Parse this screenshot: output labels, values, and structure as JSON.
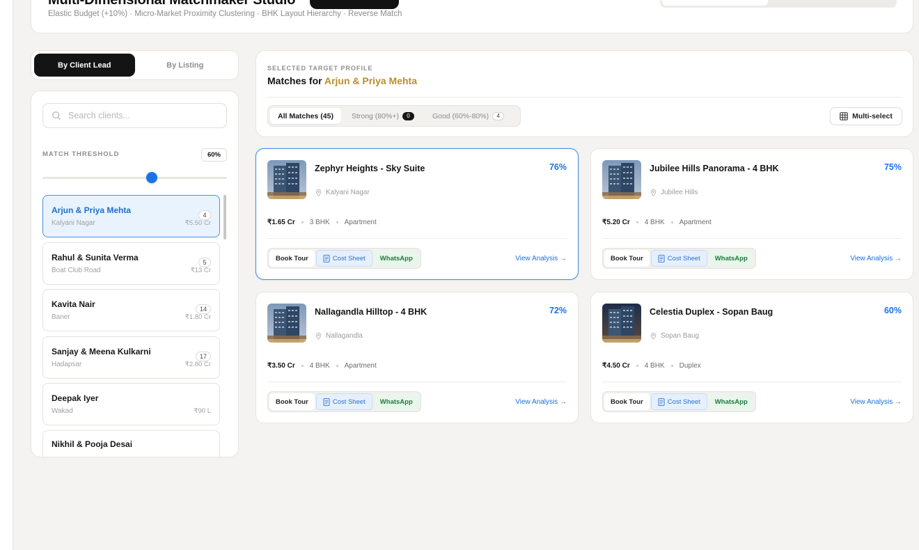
{
  "header": {
    "title": "Multi-Dimensional Matchmaker Studio",
    "subtitle": "Elastic Budget (+10%) · Micro-Market Proximity Clustering · BHK Layout Hierarchy · Reverse Match"
  },
  "mode_tabs": [
    {
      "label": "By Client Lead",
      "active": true
    },
    {
      "label": "By Listing",
      "active": false
    }
  ],
  "search": {
    "placeholder": "Search clients..."
  },
  "threshold": {
    "label": "MATCH THRESHOLD",
    "value_label": "60%",
    "value": 0.6
  },
  "clients": [
    {
      "name": "Arjun & Priya Mehta",
      "location": "Kalyani Nagar",
      "count": "4",
      "budget": "₹5.50 Cr",
      "active": true
    },
    {
      "name": "Rahul & Sunita Verma",
      "location": "Boat Club Road",
      "count": "5",
      "budget": "₹13 Cr"
    },
    {
      "name": "Kavita Nair",
      "location": "Baner",
      "count": "14",
      "budget": "₹1.80 Cr"
    },
    {
      "name": "Sanjay & Meena Kulkarni",
      "location": "Hadapsar",
      "count": "17",
      "budget": "₹2.80 Cr"
    },
    {
      "name": "Deepak Iyer",
      "location": "Wakad",
      "count": "",
      "budget": "₹90 L"
    },
    {
      "name": "Nikhil & Pooja Desai",
      "location": "",
      "count": "",
      "budget": ""
    }
  ],
  "profile": {
    "eyebrow": "SELECTED TARGET PROFILE",
    "prefix": "Matches for ",
    "client_name": "Arjun & Priya Mehta"
  },
  "filters": [
    {
      "label": "All Matches (45)",
      "count": "",
      "active": true
    },
    {
      "label": "Strong (80%+)",
      "count": "0"
    },
    {
      "label": "Good (60%-80%)",
      "count": "4"
    }
  ],
  "multi_select": {
    "label": "Multi-select"
  },
  "properties": [
    {
      "name": "Zephyr Heights - Sky Suite",
      "location": "Kalyani Nagar",
      "score": "76%",
      "price": "₹1.65 Cr",
      "bhk": "3 BHK",
      "type": "Apartment",
      "selected": true
    },
    {
      "name": "Jubilee Hills Panorama - 4 BHK",
      "location": "Jubilee Hills",
      "score": "75%",
      "price": "₹5.20 Cr",
      "bhk": "4 BHK",
      "type": "Apartment"
    },
    {
      "name": "Nallagandla Hilltop - 4 BHK",
      "location": "Nallagandla",
      "score": "72%",
      "price": "₹3.50 Cr",
      "bhk": "4 BHK",
      "type": "Apartment"
    },
    {
      "name": "Celestia Duplex - Sopan Baug",
      "location": "Sopan Baug",
      "score": "60%",
      "price": "₹4.50 Cr",
      "bhk": "4 BHK",
      "type": "Duplex"
    }
  ],
  "card_actions": {
    "book_tour": "Book Tour",
    "cost_sheet": "Cost Sheet",
    "whatsapp": "WhatsApp",
    "view_analysis": "View Analysis →"
  },
  "colors": {
    "accent": "#1b72e8",
    "client_highlight": "#b88f2e",
    "whatsapp": "#1f7a3c"
  }
}
